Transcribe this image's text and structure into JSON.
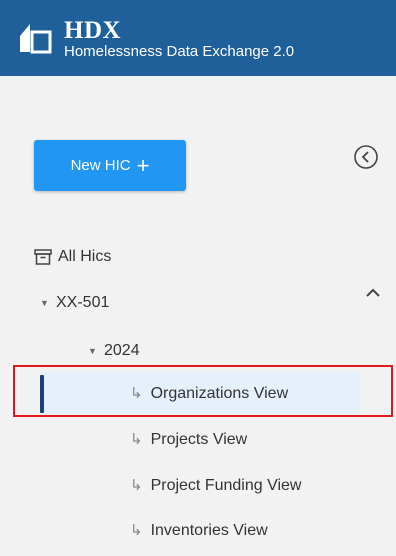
{
  "header": {
    "brand": "HDX",
    "subtitle": "Homelessness Data Exchange 2.0"
  },
  "actions": {
    "new_hic_label": "New HIC",
    "new_hic_plus": "+"
  },
  "nav": {
    "all_hics": "All Hics",
    "coc": "XX-501",
    "year": "2024",
    "views": [
      {
        "label": "Organizations View",
        "active": true
      },
      {
        "label": "Projects View",
        "active": false
      },
      {
        "label": "Project Funding View",
        "active": false
      },
      {
        "label": "Inventories View",
        "active": false
      }
    ],
    "sub_arrow": "↳"
  },
  "colors": {
    "header_bg": "#1f5f9a",
    "button_bg": "#2196f3",
    "active_bg": "#e6f0fb",
    "active_bar": "#1f3f7a",
    "highlight": "#e21a1a"
  }
}
